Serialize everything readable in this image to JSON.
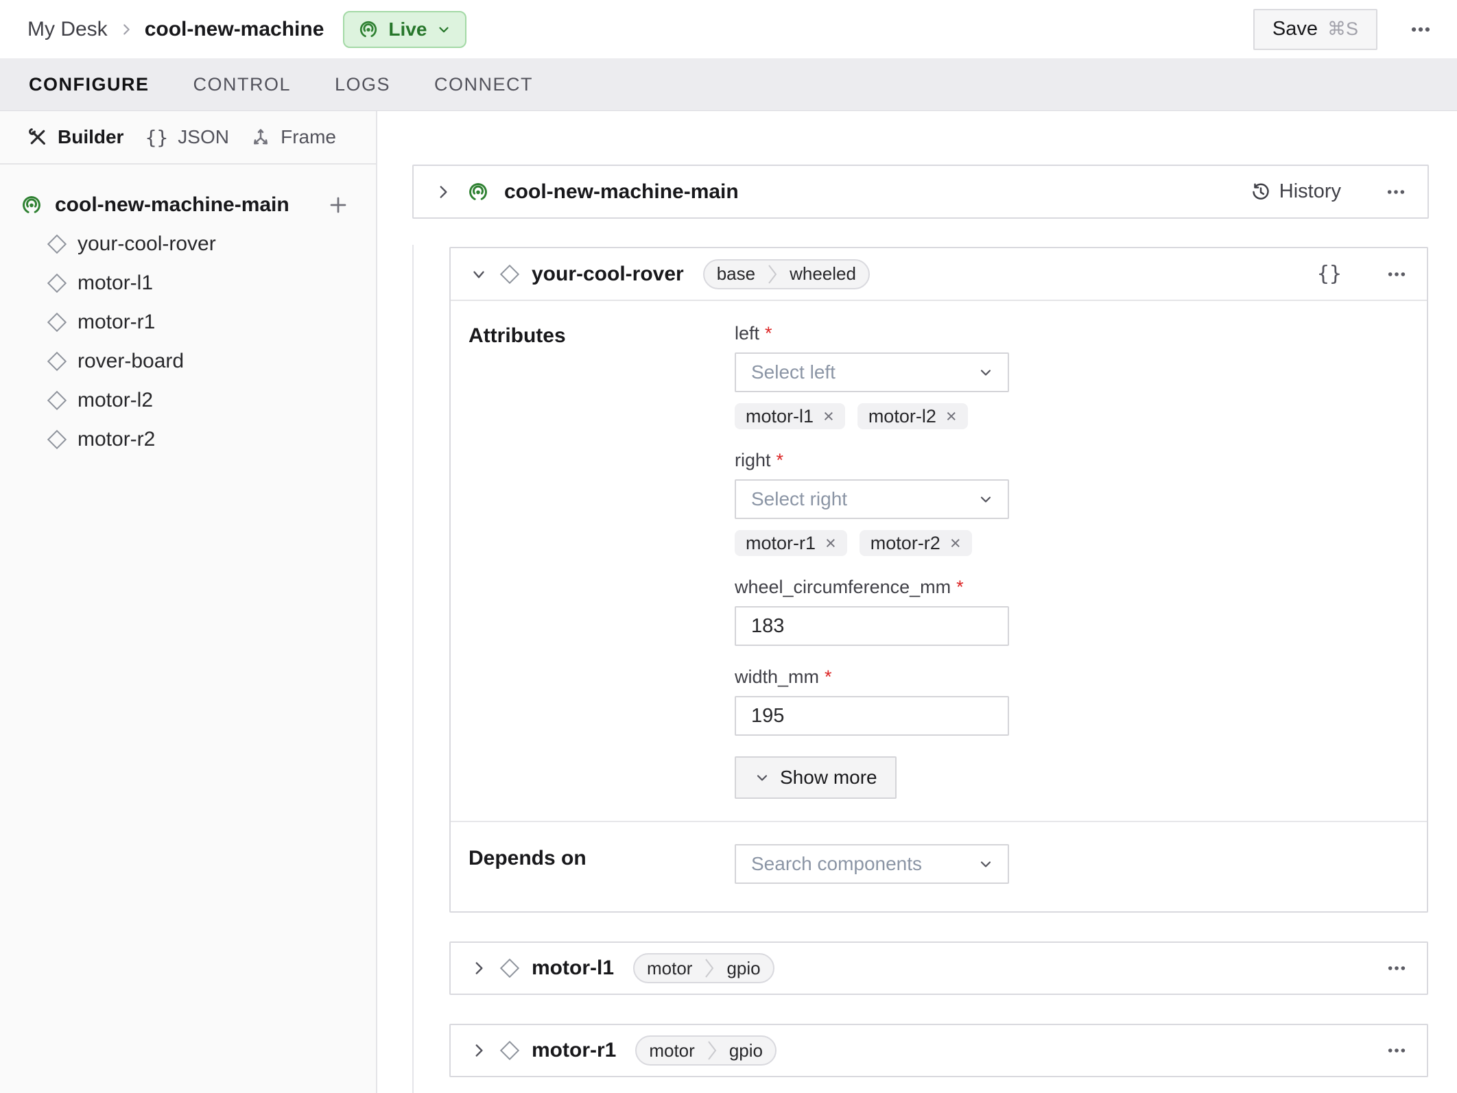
{
  "topbar": {
    "breadcrumb_parent": "My Desk",
    "breadcrumb_current": "cool-new-machine",
    "live_label": "Live",
    "save_label": "Save",
    "save_shortcut": "⌘S"
  },
  "tabs": [
    {
      "label": "CONFIGURE"
    },
    {
      "label": "CONTROL"
    },
    {
      "label": "LOGS"
    },
    {
      "label": "CONNECT"
    }
  ],
  "sidebar": {
    "builder_label": "Builder",
    "json_label": "JSON",
    "frame_label": "Frame",
    "tree_root": "cool-new-machine-main",
    "tree_items": [
      "your-cool-rover",
      "motor-l1",
      "motor-r1",
      "rover-board",
      "motor-l2",
      "motor-r2"
    ]
  },
  "main": {
    "part": {
      "title": "cool-new-machine-main",
      "history_label": "History"
    },
    "rover": {
      "title": "your-cool-rover",
      "badge_left": "base",
      "badge_right": "wheeled",
      "attributes_label": "Attributes",
      "left_label": "left",
      "left_placeholder": "Select left",
      "left_chips": [
        "motor-l1",
        "motor-l2"
      ],
      "right_label": "right",
      "right_placeholder": "Select right",
      "right_chips": [
        "motor-r1",
        "motor-r2"
      ],
      "wheel_label": "wheel_circumference_mm",
      "wheel_value": "183",
      "width_label": "width_mm",
      "width_value": "195",
      "show_more_label": "Show more",
      "depends_label": "Depends on",
      "depends_placeholder": "Search components"
    },
    "motor_cards": [
      {
        "title": "motor-l1",
        "badge_left": "motor",
        "badge_right": "gpio"
      },
      {
        "title": "motor-r1",
        "badge_left": "motor",
        "badge_right": "gpio"
      }
    ]
  },
  "ui": {
    "close": "×",
    "required": "*",
    "braces": "{}"
  },
  "colors": {
    "live_green": "#26762a",
    "live_bg": "#ddf3de",
    "card_border": "#d9d9de",
    "required_red": "#dc2626"
  }
}
